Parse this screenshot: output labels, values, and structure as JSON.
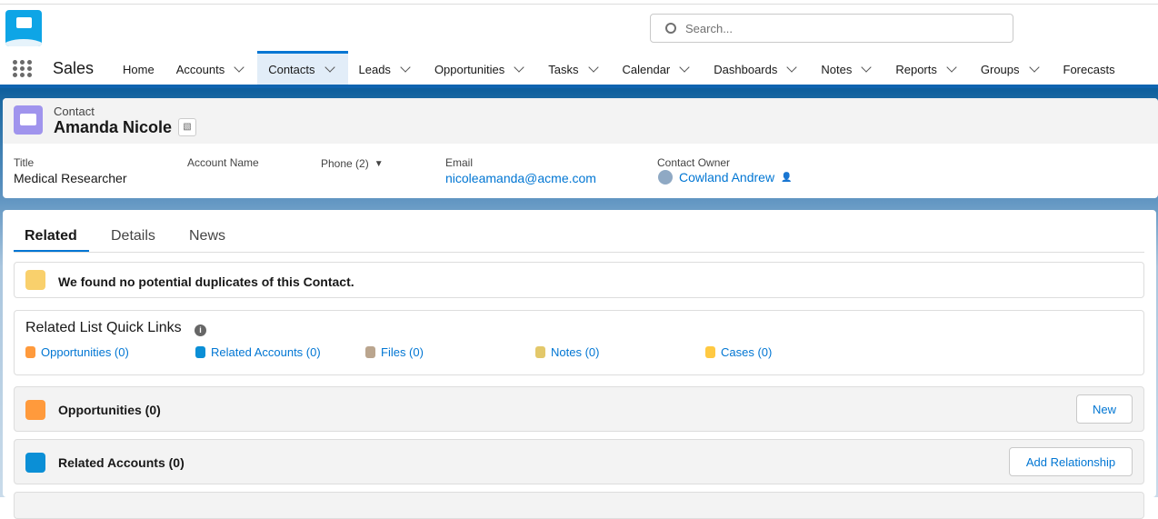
{
  "search": {
    "placeholder": "Search..."
  },
  "app": {
    "name": "Sales"
  },
  "nav": [
    {
      "label": "Home",
      "menu": false
    },
    {
      "label": "Accounts",
      "menu": true
    },
    {
      "label": "Contacts",
      "menu": true,
      "active": true
    },
    {
      "label": "Leads",
      "menu": true
    },
    {
      "label": "Opportunities",
      "menu": true
    },
    {
      "label": "Tasks",
      "menu": true
    },
    {
      "label": "Calendar",
      "menu": true
    },
    {
      "label": "Dashboards",
      "menu": true
    },
    {
      "label": "Notes",
      "menu": true
    },
    {
      "label": "Reports",
      "menu": true
    },
    {
      "label": "Groups",
      "menu": true
    },
    {
      "label": "Forecasts",
      "menu": false
    }
  ],
  "record": {
    "type": "Contact",
    "name": "Amanda Nicole",
    "fields": {
      "title_label": "Title",
      "title": "Medical Researcher",
      "account_label": "Account Name",
      "phone_label": "Phone (2)",
      "email_label": "Email",
      "email": "nicoleamanda@acme.com",
      "owner_label": "Contact Owner",
      "owner": "Cowland Andrew"
    }
  },
  "tabs": {
    "related": "Related",
    "details": "Details",
    "news": "News"
  },
  "duplicates": {
    "message": "We found no potential duplicates of this Contact."
  },
  "quick_links": {
    "title": "Related List Quick Links",
    "items": [
      {
        "label": "Opportunities (0)",
        "color": "#ff9a3c"
      },
      {
        "label": "Related Accounts (0)",
        "color": "#0b8fd6"
      },
      {
        "label": "Files (0)",
        "color": "#baa58e"
      },
      {
        "label": "Notes (0)",
        "color": "#e3c86a"
      },
      {
        "label": "Cases (0)",
        "color": "#ffc942"
      }
    ]
  },
  "cards": {
    "opportunities": {
      "title": "Opportunities (0)",
      "button": "New"
    },
    "related_accounts": {
      "title": "Related Accounts (0)",
      "button": "Add Relationship"
    }
  }
}
